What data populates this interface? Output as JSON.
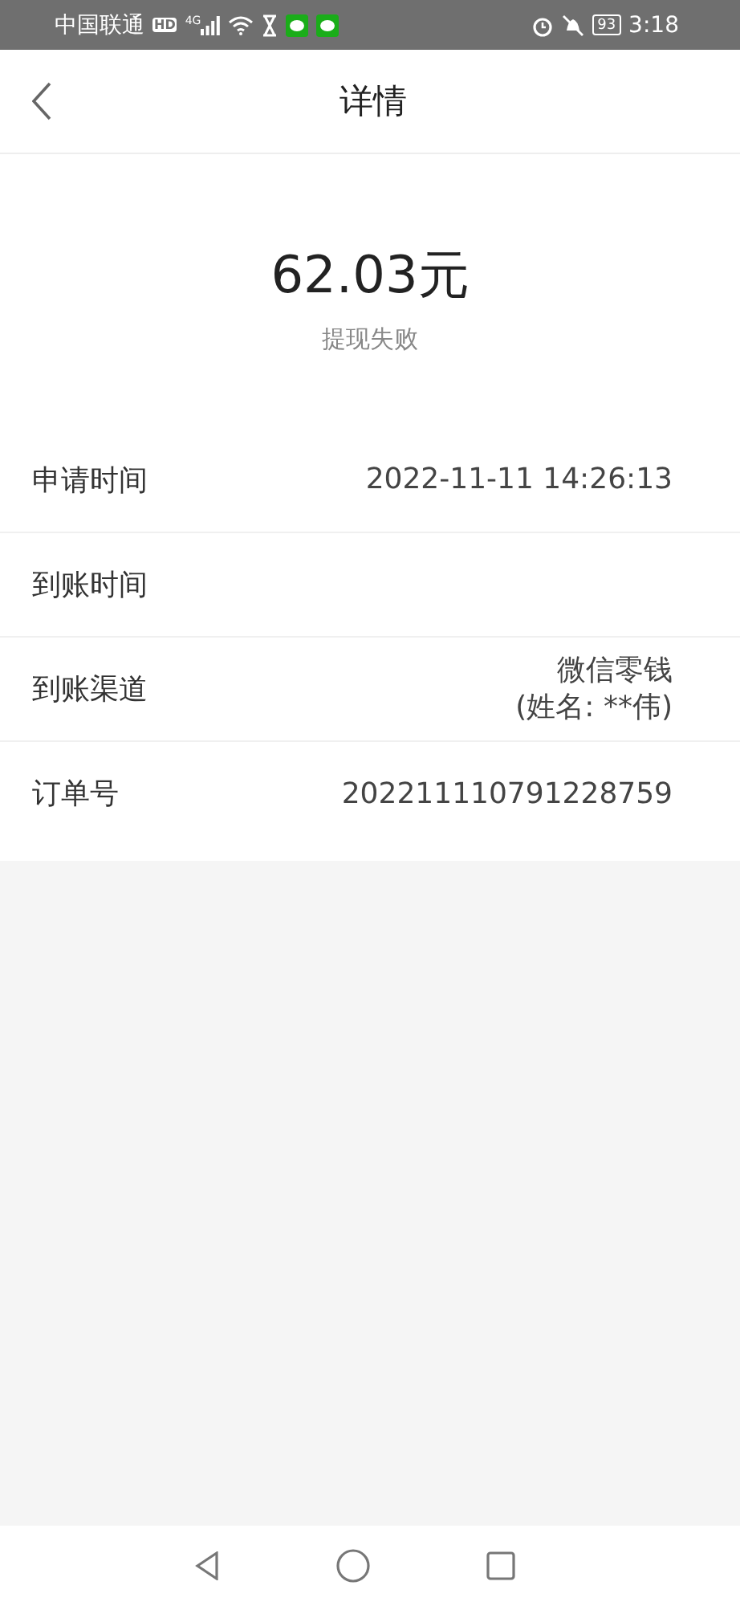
{
  "status_bar": {
    "carrier": "中国联通",
    "hd": "HD",
    "network": "4G",
    "battery": "93",
    "time": "3:18"
  },
  "header": {
    "title": "详情"
  },
  "summary": {
    "amount": "62.03元",
    "status": "提现失败"
  },
  "rows": [
    {
      "label": "申请时间",
      "value": [
        "2022-11-11 14:26:13"
      ]
    },
    {
      "label": "到账时间",
      "value": []
    },
    {
      "label": "到账渠道",
      "value": [
        "微信零钱",
        "(姓名: **伟)"
      ]
    },
    {
      "label": "订单号",
      "value": [
        "202211110791228759"
      ]
    }
  ]
}
